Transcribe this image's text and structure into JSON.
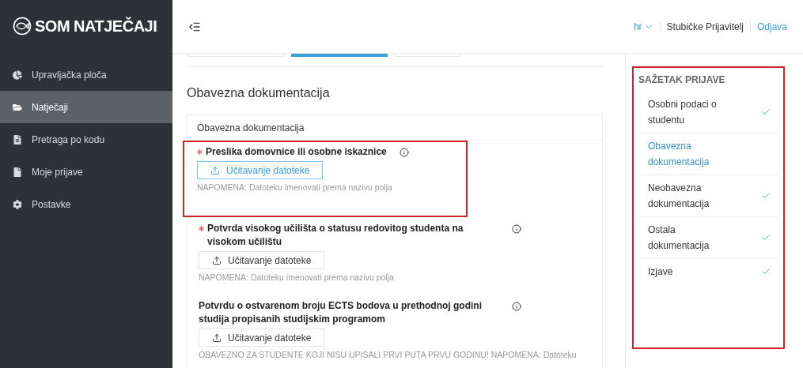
{
  "logo": {
    "text": "SOM NATJEČAJI"
  },
  "sidebar": {
    "items": [
      {
        "label": "Upravljačka ploča",
        "selected": false
      },
      {
        "label": "Natječaji",
        "selected": true
      },
      {
        "label": "Pretraga po kodu",
        "selected": false
      },
      {
        "label": "Moje prijave",
        "selected": false
      },
      {
        "label": "Postavke",
        "selected": false
      }
    ]
  },
  "header": {
    "language": "hr",
    "user": "Stubičke Prijavitelj",
    "logout": "Odjava"
  },
  "tabs": [
    {
      "selected": false
    },
    {
      "selected": true
    },
    {
      "selected": false
    }
  ],
  "page_title": "Obavezna dokumentacija",
  "card": {
    "title": "Obavezna dokumentacija",
    "fields": [
      {
        "label": "Preslika domovnice ili osobne iskaznice",
        "required": true,
        "highlighted": true,
        "upload": {
          "label": "Učitavanje datoteke",
          "active": true
        },
        "note": "NAPOMENA: Datoteku imenovati prema nazivu polja"
      },
      {
        "label": "Potvrda visokog učilišta o statusu redovitog studenta na visokom učilištu",
        "required": true,
        "highlighted": false,
        "upload": {
          "label": "Učitavanje datoteke",
          "active": false
        },
        "note": "NAPOMENA: Datoteku imenovati prema nazivu polja"
      },
      {
        "label": "Potvrdu o ostvarenom broju ECTS bodova u prethodnoj godini studija propisanih studijskim programom",
        "required": false,
        "highlighted": false,
        "upload": {
          "label": "Učitavanje datoteke",
          "active": false
        },
        "note": "OBAVEZNO ZA STUDENTE KOJI NISU UPISALI PRVI PUTA PRVU GODINU! NAPOMENA: Datoteku"
      }
    ]
  },
  "summary": {
    "title": "SAŽETAK PRIJAVE",
    "highlighted": true,
    "items": [
      {
        "label": "Osobni podaci o studentu",
        "selected": false,
        "done": true
      },
      {
        "label": "Obavezna dokumentacija",
        "selected": true,
        "done": false
      },
      {
        "label": "Neobavezna dokumentacija",
        "selected": false,
        "done": true
      },
      {
        "label": "Ostala dokumentacija",
        "selected": false,
        "done": true
      },
      {
        "label": "Izjave",
        "selected": false,
        "done": true
      }
    ]
  }
}
